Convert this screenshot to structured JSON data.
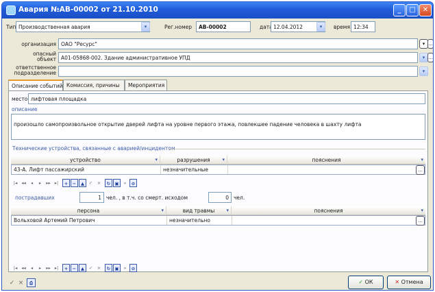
{
  "window": {
    "title": "Авария №АВ-00002 от 21.10.2010"
  },
  "header": {
    "type_label": "Тип",
    "type_value": "Производственная авария",
    "regnum_label": "Рег.номер",
    "regnum_value": "АВ-00002",
    "date_label": "дата",
    "date_value": "12.04.2012",
    "time_label": "время",
    "time_value": "12:34"
  },
  "form": {
    "organization_label": "организация",
    "organization_value": "ОАО \"Ресурс\"",
    "hazard_label_1": "опасный",
    "hazard_label_2": "объект",
    "hazard_value": "А01-05868-002. Здание административное УПД",
    "department_label_1": "ответственное",
    "department_label_2": "подразделение",
    "department_value": ""
  },
  "tabs": [
    {
      "label": "Описание событий"
    },
    {
      "label": "Комиссия, причины"
    },
    {
      "label": "Мероприятия"
    }
  ],
  "event": {
    "place_label": "место",
    "place_value": "лифтовая площадка",
    "description_label": "описание",
    "description_value": "произошло самопроизвольное открытие дверей лифта на уровне первого этажа, повлекшее падение человека в шахту лифта"
  },
  "devices": {
    "group_title": "Технические устройства, связанные с аварией/инцидентом",
    "columns": [
      "устройство",
      "разрушения",
      "пояснения"
    ],
    "rows": [
      [
        "43-А. Лифт пассажирский",
        "незначительные",
        ""
      ]
    ]
  },
  "victims": {
    "label": "пострадавших",
    "count": "1",
    "unit1": "чел. , в т.ч. со смерт. исходом",
    "fatal": "0",
    "unit2": "чел.",
    "columns": [
      "персона",
      "вид травмы",
      "пояснения"
    ],
    "rows": [
      [
        "Вольховой Артемий Петрович",
        "незначительно",
        ""
      ]
    ]
  },
  "buttons": {
    "ok": "ОК",
    "cancel": "Отмена"
  },
  "nav": [
    "|◂",
    "◂◂",
    "◂",
    "▸",
    "▸▸",
    "▸|",
    "+",
    "−",
    "▲",
    "✓",
    "×",
    "↻",
    "▣",
    "⊘"
  ]
}
